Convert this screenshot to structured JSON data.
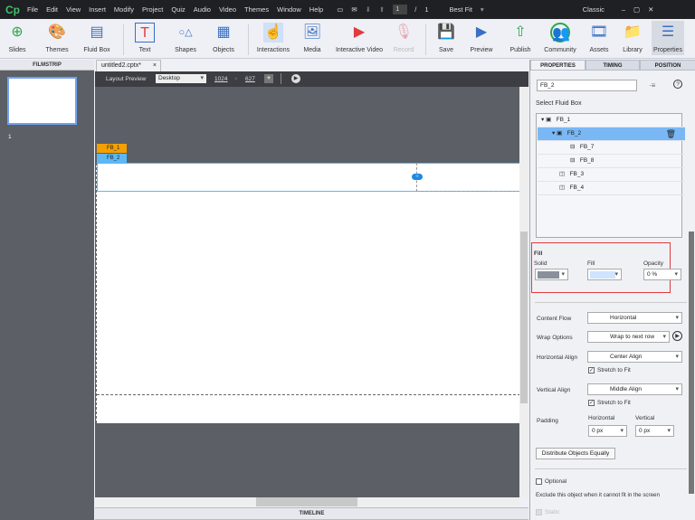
{
  "app": {
    "logo": "Cp",
    "menu": [
      "File",
      "Edit",
      "View",
      "Insert",
      "Modify",
      "Project",
      "Quiz",
      "Audio",
      "Video",
      "Themes",
      "Window",
      "Help"
    ],
    "page_current": "1",
    "page_sep": "/",
    "page_total": "1",
    "zoom": "Best Fit",
    "workspace": "Classic"
  },
  "toolbar": {
    "slides": "Slides",
    "themes": "Themes",
    "fluid_box": "Fluid Box",
    "text": "Text",
    "shapes": "Shapes",
    "objects": "Objects",
    "interactions": "Interactions",
    "media": "Media",
    "interactive_video": "Interactive Video",
    "record": "Record",
    "save": "Save",
    "preview": "Preview",
    "publish": "Publish",
    "community": "Community",
    "assets": "Assets",
    "library": "Library",
    "properties": "Properties"
  },
  "filmstrip": {
    "title": "FILMSTRIP",
    "slide_number": "1"
  },
  "document": {
    "tab": "untitled2.cptx*",
    "layout_preview_label": "Layout Preview",
    "device": "Desktop",
    "width": "1024",
    "times": "×",
    "height": "627"
  },
  "stage": {
    "labels": [
      "FB_1",
      "FB_2"
    ]
  },
  "timeline": {
    "title": "TIMELINE"
  },
  "panel": {
    "tabs": [
      "PROPERTIES",
      "TIMING",
      "POSITION"
    ],
    "name": "FB_2",
    "select_label": "Select Fluid Box",
    "tree": [
      "FB_1",
      "FB_2",
      "FB_7",
      "FB_8",
      "FB_3",
      "FB_4"
    ],
    "fill": {
      "title": "Fill",
      "solid": "Solid",
      "fill_label": "Fill",
      "opacity_label": "Opacity",
      "opacity": "0 %",
      "solid_color": "#8a8f9c",
      "fill_color": "#cfe4ff"
    },
    "content_flow_label": "Content Flow",
    "content_flow": "Horizontal",
    "wrap_label": "Wrap Options",
    "wrap": "Wrap to next row",
    "halign_label": "Horizontal Align",
    "halign": "Center Align",
    "stretch1": "Stretch to Fit",
    "valign_label": "Vertical Align",
    "valign": "Middle Align",
    "stretch2": "Stretch to Fit",
    "padding_label": "Padding",
    "pad_h_label": "Horizontal",
    "pad_v_label": "Vertical",
    "pad_h": "0 px",
    "pad_v": "0 px",
    "distribute": "Distribute Objects Equally",
    "optional": "Optional",
    "optional_desc": "Exclude this object when it cannot fit in the screen",
    "static": "Static"
  },
  "colors": {
    "highlight": "#e03a3e",
    "selection": "#7ab8f5",
    "fb1": "#f5a000",
    "fb2": "#5bb8f5"
  }
}
